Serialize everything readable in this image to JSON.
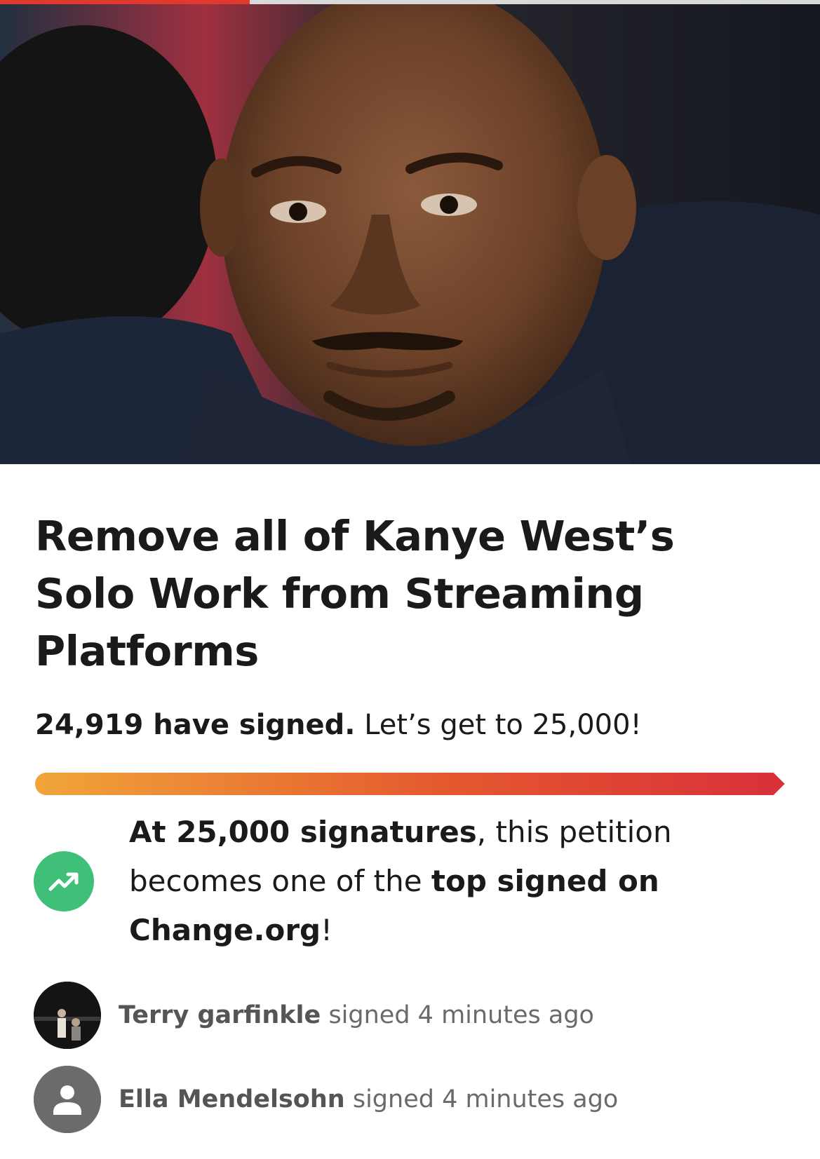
{
  "petition": {
    "title": "Remove all of Kanye West’s Solo Work from Streaming Platforms",
    "signed_count": "24,919 have signed.",
    "signed_goal": "Let’s get to 25,000!",
    "progress_fraction": 0.9968
  },
  "milestone": {
    "part1_bold": "At 25,000 signatures",
    "part2": ", this petition becomes one of the ",
    "part3_bold": "top signed on Change.org",
    "part4": "!",
    "icon": "trending-up-icon"
  },
  "signers": [
    {
      "name": "Terry garfinkle",
      "action": "signed 4 minutes ago",
      "avatar": "photo"
    },
    {
      "name": "Ella Mendelsohn",
      "action": "signed 4 minutes ago",
      "avatar": "default-user-icon"
    }
  ],
  "colors": {
    "progress_start": "#f1a53a",
    "progress_end": "#d8303a",
    "milestone_green": "#3fbf78",
    "top_bar_accent": "#e03a2f"
  }
}
